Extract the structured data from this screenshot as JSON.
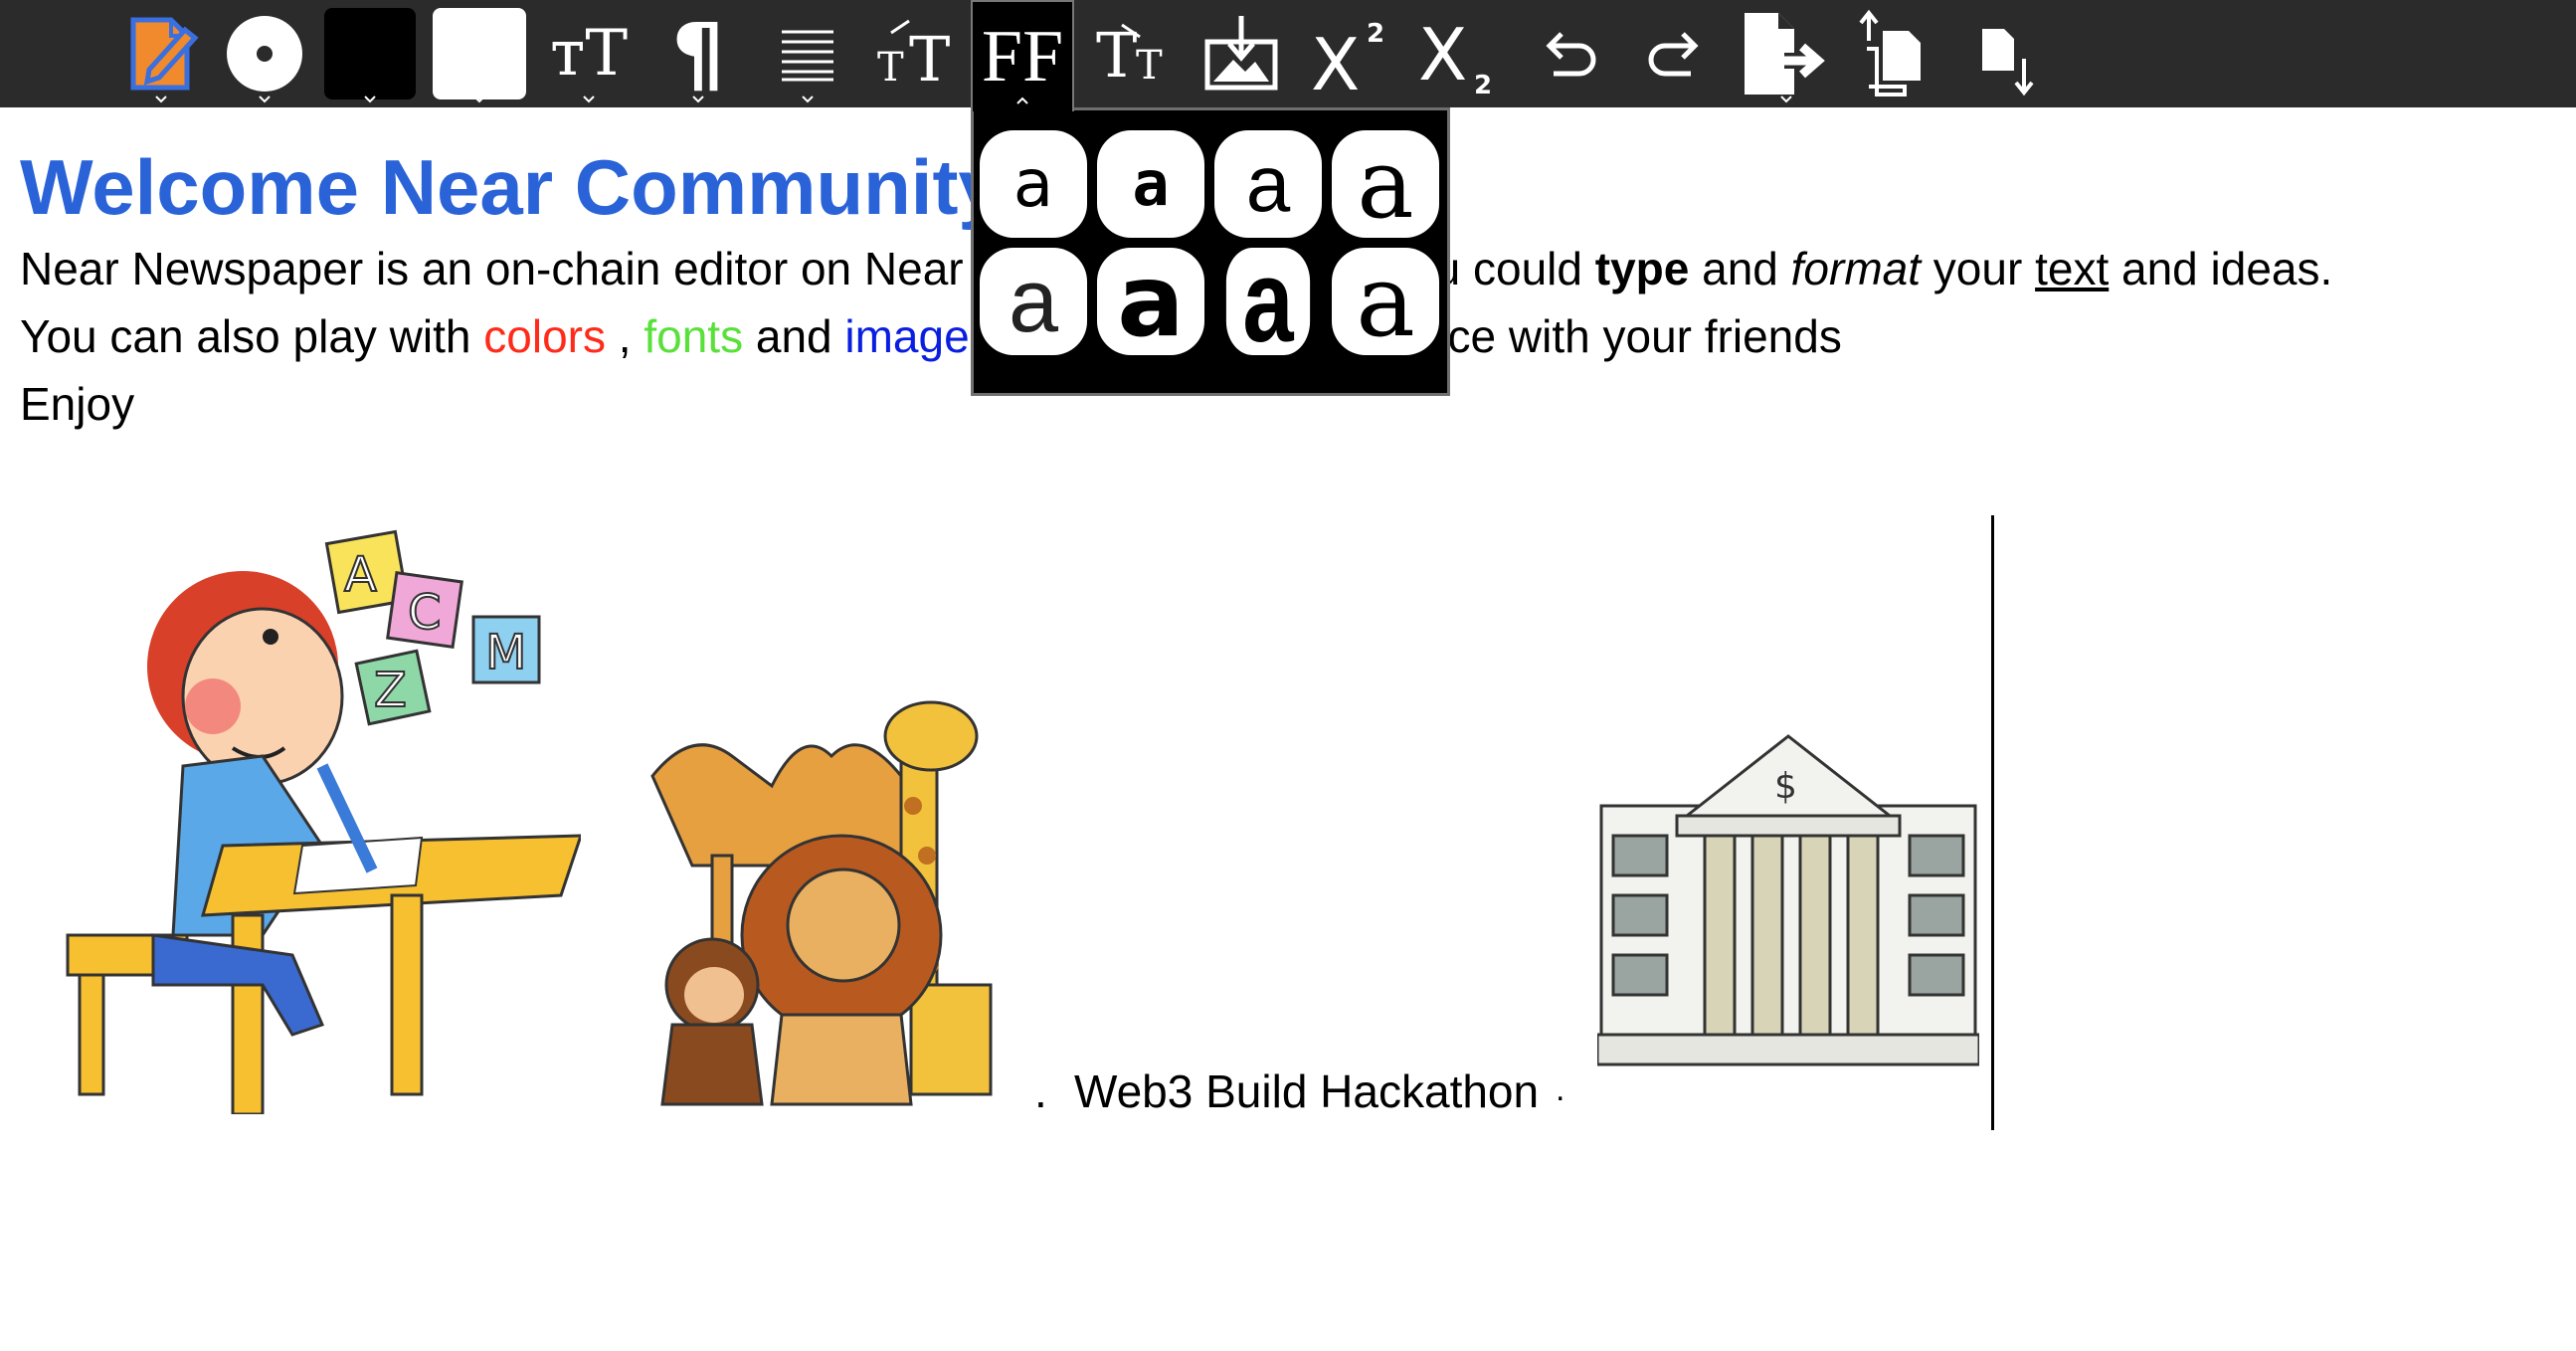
{
  "toolbar": {
    "buttons": [
      {
        "name": "edit-note-icon",
        "label": ""
      },
      {
        "name": "disc-icon",
        "label": ""
      },
      {
        "name": "text-color-swatch",
        "label": ""
      },
      {
        "name": "background-color-swatch",
        "label": ""
      },
      {
        "name": "font-size-icon",
        "glyph": "ᴛT"
      },
      {
        "name": "paragraph-icon",
        "glyph": "¶"
      },
      {
        "name": "align-icon",
        "glyph": "≣"
      },
      {
        "name": "increase-size-icon",
        "glyph": "ᴛT"
      },
      {
        "name": "font-family-icon",
        "glyph": "FF"
      },
      {
        "name": "text-transform-icon",
        "glyph": "Tᴛ"
      },
      {
        "name": "insert-image-icon",
        "glyph": ""
      },
      {
        "name": "superscript-icon",
        "glyph": "X²"
      },
      {
        "name": "subscript-icon",
        "glyph": "X₂"
      },
      {
        "name": "undo-icon",
        "glyph": "↶"
      },
      {
        "name": "redo-icon",
        "glyph": "↷"
      },
      {
        "name": "export-icon",
        "glyph": ""
      },
      {
        "name": "upload-icon",
        "glyph": ""
      },
      {
        "name": "download-icon",
        "glyph": ""
      }
    ],
    "active": "font-family-icon"
  },
  "font_menu": {
    "options": [
      "a",
      "a",
      "a",
      "a",
      "a",
      "a",
      "a",
      "a"
    ]
  },
  "document": {
    "title": "Welcome Near Community",
    "line1_start": "Near Newspaper is an on-chain editor on Near",
    "line1_could": "u could ",
    "line1_type": "type",
    "line1_and1": " and ",
    "line1_format": "format",
    "line1_your": " your ",
    "line1_text": "text",
    "line1_end": " and ideas.",
    "line2_start": "You can also play with ",
    "line2_colors": "colors",
    "line2_comma": " , ",
    "line2_fonts": "fonts",
    "line2_and": " and ",
    "line2_images": "images",
    "line2_end": "perience with your friends",
    "line3": "Enjoy",
    "caption_dot": ".",
    "caption": "Web3 Build Hackathon",
    "caption_end": "."
  },
  "colors": {
    "title": "#2a63d8",
    "red": "#ff2a1a",
    "green": "#5ae03a",
    "blue": "#0a1ee0",
    "toolbar_bg": "#2b2b2b"
  }
}
